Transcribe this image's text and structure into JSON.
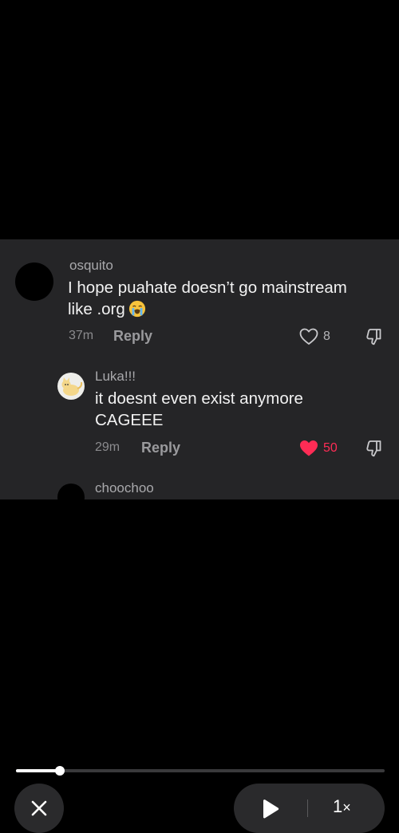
{
  "comments": [
    {
      "username": "osquito",
      "text_line1": "I hope puahate doesn’t go mainstream",
      "text_line2": "like .org",
      "emoji": "crying-face",
      "time": "37m",
      "reply_label": "Reply",
      "likes": "8",
      "liked": false,
      "avatar": "black-circle"
    },
    {
      "username": "Luka!!!",
      "text_line1": "it doesnt even exist anymore",
      "text_line2": "CAGEEE",
      "time": "29m",
      "reply_label": "Reply",
      "likes": "50",
      "liked": true,
      "avatar": "cat-drawing"
    },
    {
      "username": "choochoo",
      "avatar": "black-circle"
    }
  ],
  "player": {
    "progress": 0.12,
    "speed_value": "1",
    "speed_suffix": "×"
  },
  "colors": {
    "background": "#000000",
    "card": "#252527",
    "like_active": "#fe2c55"
  },
  "icons": [
    "heart-outline-icon",
    "heart-filled-icon",
    "dislike-icon",
    "close-icon",
    "play-icon",
    "crying-face-emoji-icon"
  ]
}
